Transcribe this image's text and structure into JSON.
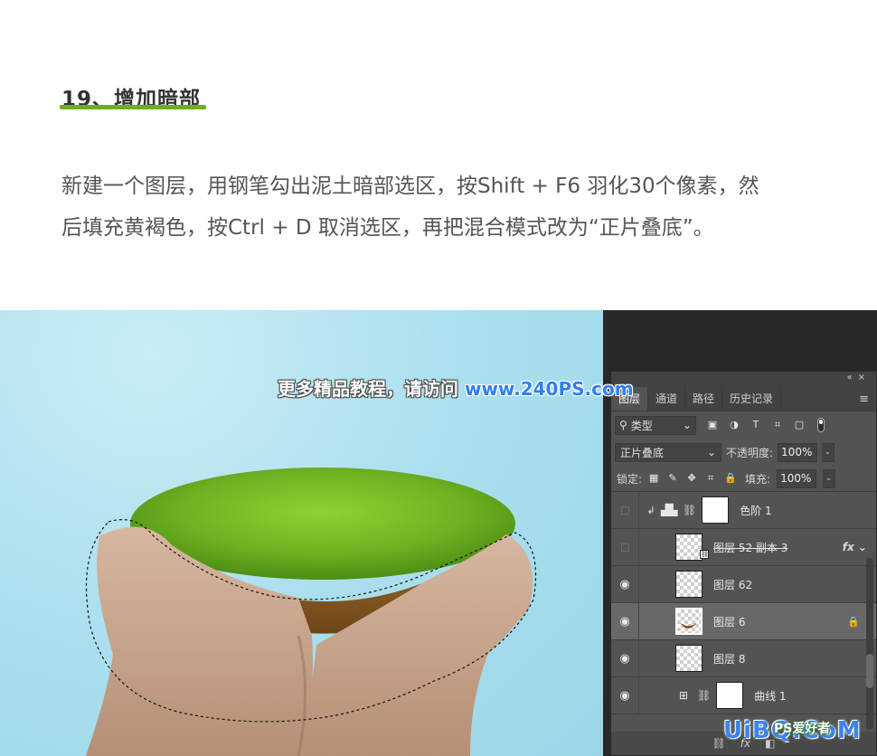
{
  "article": {
    "step_title": "19、增加暗部",
    "description_line1": "新建一个图层，用钢笔勾出泥土暗部选区，按Shift + F6 羽化30个像素，然",
    "description_line2": "后填充黄褐色，按Ctrl + D 取消选区，再把混合模式改为“正片叠底”。"
  },
  "watermark": {
    "cn_text": "更多精品教程，请访问",
    "url_text": "www.240PS.com"
  },
  "panel": {
    "tabs": [
      {
        "label": "图层"
      },
      {
        "label": "通道"
      },
      {
        "label": "路径"
      },
      {
        "label": "历史记录"
      }
    ],
    "filter": {
      "kind_label": "类型"
    },
    "blend": {
      "mode": "正片叠底",
      "opacity_label": "不透明度:",
      "opacity_value": "100%"
    },
    "lock": {
      "lock_label": "锁定:",
      "fill_label": "填充:",
      "fill_value": "100%"
    },
    "layers": [
      {
        "name": "色阶 1"
      },
      {
        "name": "图层 52 副本 3"
      },
      {
        "name": "图层 62"
      },
      {
        "name": "图层 6"
      },
      {
        "name": "图层 8"
      },
      {
        "name": "曲线 1"
      }
    ],
    "bottom_icons": [
      "link-icon",
      "fx-icon",
      "mask-icon"
    ]
  },
  "site_logo": {
    "main": "UiBQ.CoM",
    "sub": "PS爱好者"
  },
  "colors": {
    "accent_green": "#6fae1e",
    "watermark_blue": "#2f7ff0",
    "panel_bg": "#535353",
    "sky_blue": "#ade0ee"
  }
}
